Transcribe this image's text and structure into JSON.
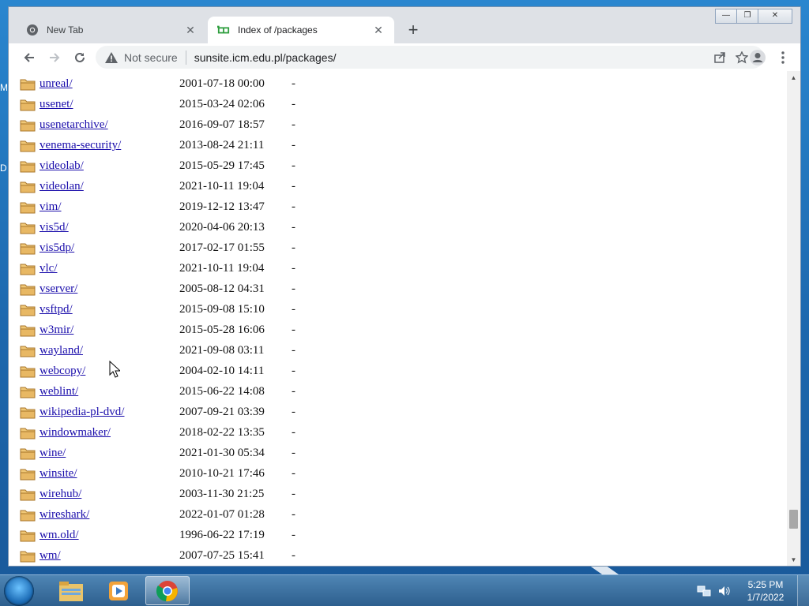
{
  "desktop": {
    "edge_letters": [
      "M",
      "D"
    ]
  },
  "browser": {
    "tabs": [
      {
        "title": "New Tab",
        "icon": "chrome-icon",
        "active": false
      },
      {
        "title": "Index of /packages",
        "icon": "site-favicon",
        "active": true
      }
    ],
    "window_controls": {
      "minimize": "—",
      "restore": "❐",
      "close": "✕"
    },
    "address": {
      "security_label": "Not secure",
      "url": "sunsite.icm.edu.pl/packages/"
    }
  },
  "listing": {
    "rows": [
      {
        "name": "unreal/",
        "date": "2001-07-18 00:00",
        "size": "-"
      },
      {
        "name": "usenet/",
        "date": "2015-03-24 02:06",
        "size": "-"
      },
      {
        "name": "usenetarchive/",
        "date": "2016-09-07 18:57",
        "size": "-"
      },
      {
        "name": "venema-security/",
        "date": "2013-08-24 21:11",
        "size": "-"
      },
      {
        "name": "videolab/",
        "date": "2015-05-29 17:45",
        "size": "-"
      },
      {
        "name": "videolan/",
        "date": "2021-10-11 19:04",
        "size": "-"
      },
      {
        "name": "vim/",
        "date": "2019-12-12 13:47",
        "size": "-"
      },
      {
        "name": "vis5d/",
        "date": "2020-04-06 20:13",
        "size": "-"
      },
      {
        "name": "vis5dp/",
        "date": "2017-02-17 01:55",
        "size": "-"
      },
      {
        "name": "vlc/",
        "date": "2021-10-11 19:04",
        "size": "-"
      },
      {
        "name": "vserver/",
        "date": "2005-08-12 04:31",
        "size": "-"
      },
      {
        "name": "vsftpd/",
        "date": "2015-09-08 15:10",
        "size": "-"
      },
      {
        "name": "w3mir/",
        "date": "2015-05-28 16:06",
        "size": "-"
      },
      {
        "name": "wayland/",
        "date": "2021-09-08 03:11",
        "size": "-"
      },
      {
        "name": "webcopy/",
        "date": "2004-02-10 14:11",
        "size": "-"
      },
      {
        "name": "weblint/",
        "date": "2015-06-22 14:08",
        "size": "-"
      },
      {
        "name": "wikipedia-pl-dvd/",
        "date": "2007-09-21 03:39",
        "size": "-"
      },
      {
        "name": "windowmaker/",
        "date": "2018-02-22 13:35",
        "size": "-"
      },
      {
        "name": "wine/",
        "date": "2021-01-30 05:34",
        "size": "-"
      },
      {
        "name": "winsite/",
        "date": "2010-10-21 17:46",
        "size": "-"
      },
      {
        "name": "wirehub/",
        "date": "2003-11-30 21:25",
        "size": "-"
      },
      {
        "name": "wireshark/",
        "date": "2022-01-07 01:28",
        "size": "-"
      },
      {
        "name": "wm.old/",
        "date": "1996-06-22 17:19",
        "size": "-"
      },
      {
        "name": "wm/",
        "date": "2007-07-25 15:41",
        "size": "-"
      }
    ]
  },
  "taskbar": {
    "items": [
      "file-explorer-icon",
      "media-player-icon",
      "chrome-icon"
    ],
    "clock": {
      "time": "5:25 PM",
      "date": "1/7/2022"
    }
  },
  "colors": {
    "link": "#1a0dab",
    "folder": "#e8b864",
    "taskbar": "#3a6f9f"
  }
}
